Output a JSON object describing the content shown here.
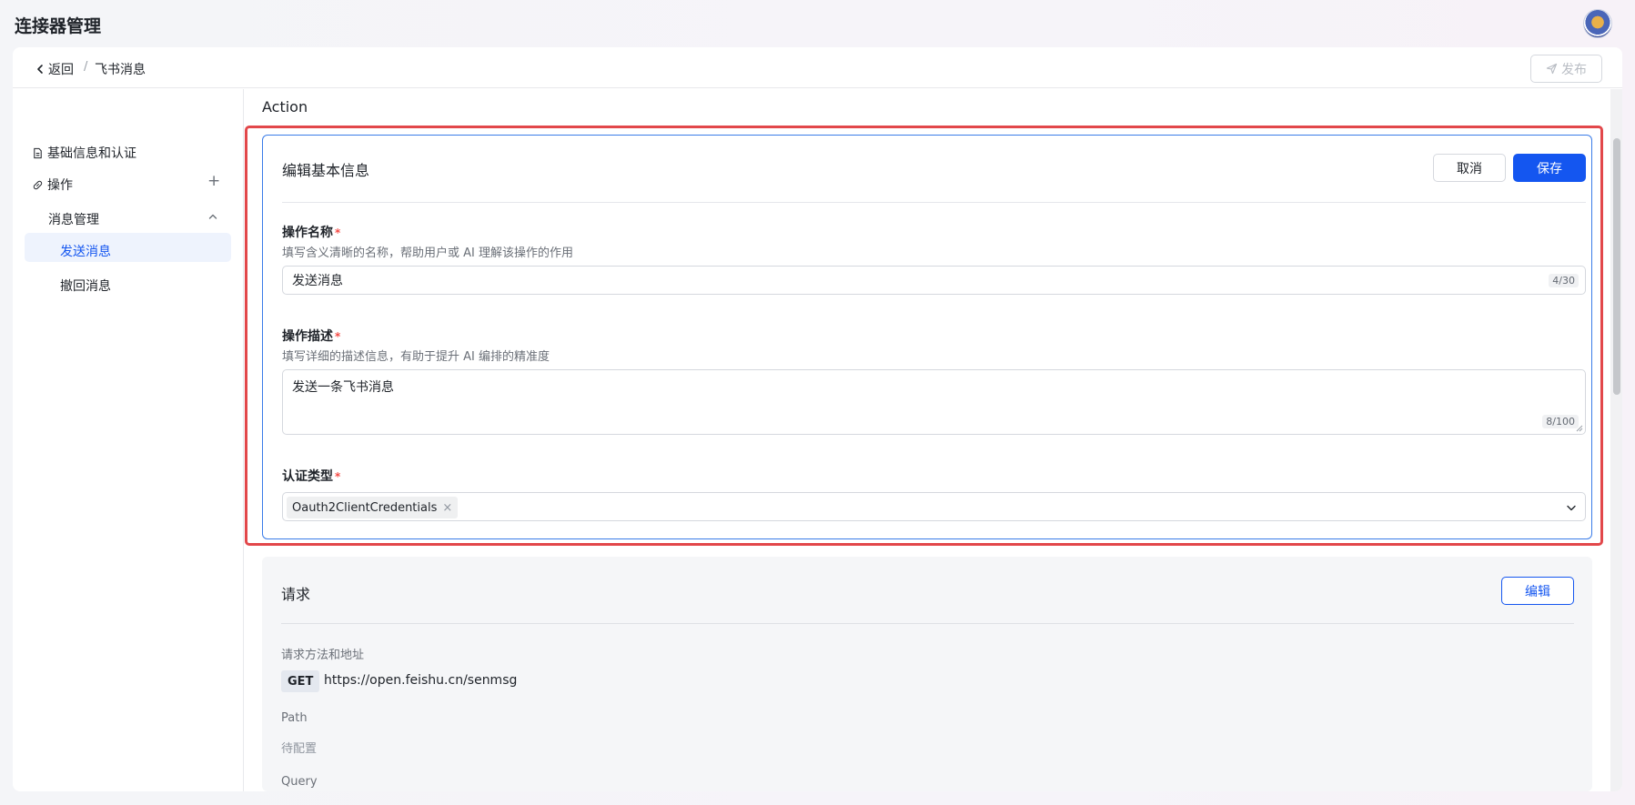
{
  "app": {
    "title": "连接器管理"
  },
  "header": {
    "back_label": "返回",
    "separator": "/",
    "current_page": "飞书消息",
    "publish_label": "发布"
  },
  "sidebar": {
    "basic_info": "基础信息和认证",
    "operations": "操作",
    "add_symbol": "+",
    "group": "消息管理",
    "items": [
      {
        "label": "发送消息",
        "active": true
      },
      {
        "label": "撤回消息",
        "active": false
      }
    ]
  },
  "main": {
    "section_title": "Action",
    "edit_panel": {
      "title": "编辑基本信息",
      "cancel_label": "取消",
      "save_label": "保存",
      "name_field": {
        "label": "操作名称",
        "required_mark": "*",
        "hint": "填写含义清晰的名称，帮助用户或 AI 理解该操作的作用",
        "value": "发送消息",
        "counter": "4/30"
      },
      "desc_field": {
        "label": "操作描述",
        "required_mark": "*",
        "hint": "填写详细的描述信息，有助于提升 AI 编排的精准度",
        "value": "发送一条飞书消息",
        "counter": "8/100"
      },
      "auth_field": {
        "label": "认证类型",
        "required_mark": "*",
        "tag": "Oauth2ClientCredentials",
        "tag_close": "×"
      }
    },
    "request_panel": {
      "title": "请求",
      "edit_label": "编辑",
      "method_label": "请求方法和地址",
      "method": "GET",
      "url": "https://open.feishu.cn/senmsg",
      "path_label": "Path",
      "path_value": "待配置",
      "query_label": "Query"
    }
  },
  "colors": {
    "primary": "#1456f0",
    "highlight_border": "#e2474a",
    "required": "#f54a45"
  }
}
